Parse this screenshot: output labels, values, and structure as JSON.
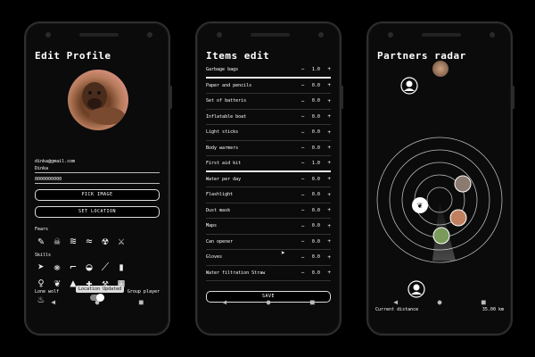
{
  "profile": {
    "title": "Edit Profile",
    "email": "dinka@gmail.com",
    "name": "Dinka",
    "phone": "0000000000",
    "pick_image": "PICK IMAGE",
    "set_location": "SET LOCATION",
    "fears_label": "Fears",
    "skills_label": "Skills",
    "lone_wolf": "Lone wolf",
    "group_player": "Group player",
    "toast": "Location Updated",
    "fear_icons": [
      "syringe-icon",
      "skull-icon",
      "wind-icon",
      "waves-icon",
      "radiation-icon",
      "crossed-swords-icon"
    ],
    "skill_icons": [
      "fish-icon",
      "paw-icon",
      "gun-icon",
      "mortar-icon",
      "knife-icon",
      "bullet-icon",
      "lollipop-icon",
      "leaf-icon",
      "tent-icon",
      "medkit-icon",
      "hammer-icon",
      "map-icon",
      "fire-icon"
    ]
  },
  "items": {
    "title": "Items edit",
    "save": "SAVE",
    "list": [
      {
        "name": "Garbage bags",
        "qty": "1.0"
      },
      {
        "name": "Paper and pencils",
        "qty": "0.0"
      },
      {
        "name": "Set of batteris",
        "qty": "0.0"
      },
      {
        "name": "Inflatable boat",
        "qty": "0.0"
      },
      {
        "name": "Light sticks",
        "qty": "0.0"
      },
      {
        "name": "Body warmers",
        "qty": "0.0"
      },
      {
        "name": "First aid kit",
        "qty": "1.0"
      },
      {
        "name": "Water per day",
        "qty": "0.0"
      },
      {
        "name": "Flashlight",
        "qty": "0.0"
      },
      {
        "name": "Dust mask",
        "qty": "0.0"
      },
      {
        "name": "Maps",
        "qty": "0.0"
      },
      {
        "name": "Can opener",
        "qty": "0.0"
      },
      {
        "name": "Gloves",
        "qty": "0.0"
      },
      {
        "name": "Water filtration Straw",
        "qty": "0.0"
      }
    ]
  },
  "radar": {
    "title": "Partners radar",
    "distance_label": "Current distance",
    "distance_value": "35.00 km",
    "slider_fraction": 0.93
  },
  "nav": {
    "back": "◀",
    "home": "●",
    "recent": "■"
  }
}
